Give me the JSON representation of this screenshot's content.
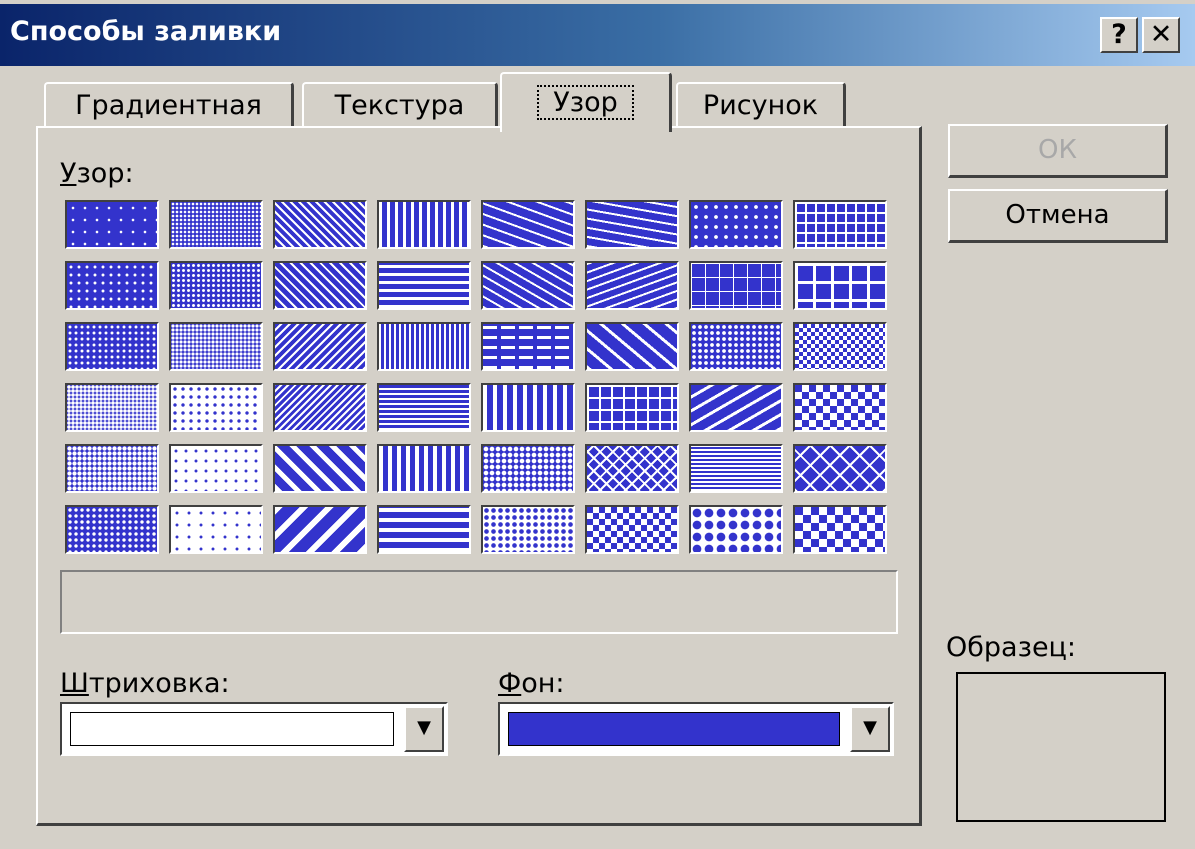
{
  "window": {
    "title": "Способы заливки",
    "help_label": "?",
    "close_label": "✕"
  },
  "tabs": [
    {
      "label": "Градиентная",
      "active": false
    },
    {
      "label": "Текстура",
      "active": false
    },
    {
      "label": "Узор",
      "active": true
    },
    {
      "label": "Рисунок",
      "active": false
    }
  ],
  "pattern_section": {
    "label_underlined": "У",
    "label_rest": "зор:",
    "pattern_count": 48
  },
  "hatch": {
    "label_underlined": "Ш",
    "label_rest": "триховка:",
    "color": "#ffffff"
  },
  "background": {
    "label_underlined": "Ф",
    "label_rest": "он:",
    "color": "#3333cc"
  },
  "buttons": {
    "ok": "ОК",
    "cancel": "Отмена"
  },
  "sample": {
    "label": "Образец:"
  },
  "colors": {
    "pattern_fg": "#ffffff",
    "pattern_bg": "#3333cc",
    "dialog_bg": "#d4d0c8"
  }
}
